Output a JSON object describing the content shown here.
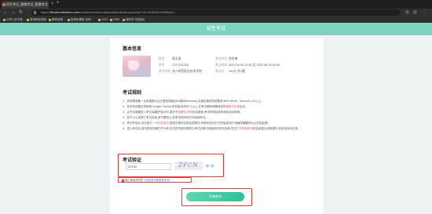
{
  "browser": {
    "tab_title": "招生考试_鹅鹅考试_智慧考试",
    "url_prefix": "https://",
    "url_domain": "htmall.zhihuishu.com",
    "url_path": "/onlineexam/bcenterp/studentexam/preview/?id=9348490-8098&Ac1",
    "bookmarks": [
      "已导入的书签",
      "常用网站导航",
      "教育资源",
      "智慧树课堂 全球...",
      "OCR",
      "CRM",
      "我的学习控制台"
    ]
  },
  "header": {
    "title": "招生考试"
  },
  "basic_info": {
    "section_title": "基本信息",
    "rows": [
      {
        "label": "姓名",
        "value": "周玉昌"
      },
      {
        "label": "考试科目",
        "value": "综合课"
      },
      {
        "label": "学号",
        "value": "1727191208"
      },
      {
        "label": "考试时间",
        "value": "2022.04.09 12:50 至 2022.08.16 00:00"
      },
      {
        "label": "考试学校",
        "value": "长沙师范职业技术学院"
      },
      {
        "label": "考试分",
        "value": "100分 共1题"
      }
    ]
  },
  "rules": {
    "section_title": "考试规则",
    "items": [
      {
        "pre": "1、考前需准备一台有摄像头且已登录电脑(Mac使用Windows),并满足最低系统要求(Win7/Win8、Macos10.12以上)",
        "hl": "",
        "post": ""
      },
      {
        "pre": "2、在所有设置必须使用 Google Chrome浏览器,版本在71以上,在考试期间请确保你的",
        "hl": "摄像头正常",
        "post": "启动。"
      },
      {
        "pre": "3、点开试卷题进入考试,每题开始计时,离开",
        "hl": "考试题目",
        "post": ",计时仍会继续,考试时间结束系统将自动收卷。"
      },
      {
        "pre": "4、若不小心关掉了考试页面,请不要担心,在考试时间内仍可继续考试。",
        "hl": "",
        "post": ""
      },
      {
        "pre": "5、考试开启后,务必进行",
        "hl": "一次在线测试",
        "post": ",按提示操作后将会查看你,系统将对你正式开始(若用于纸播录播题则为从开始监督)"
      },
      {
        "pre": "6、进入考试后,请无把浏览器打开与考试无关的网页或软件,考试过程中请保持在考试页面,学生",
        "hl": "打开其他网页",
        "post": "将会被视为违规操作,系统将自动记录。"
      }
    ]
  },
  "verify": {
    "section_title": "考试验证",
    "input_value": "ZFCN",
    "captcha_text": "ZFCN",
    "refresh_label": "换一张"
  },
  "agreement": {
    "text": "我已阅读并同意",
    "link": "《在线考试诚信承诺书》"
  },
  "start_button": {
    "label": "开始考试"
  }
}
